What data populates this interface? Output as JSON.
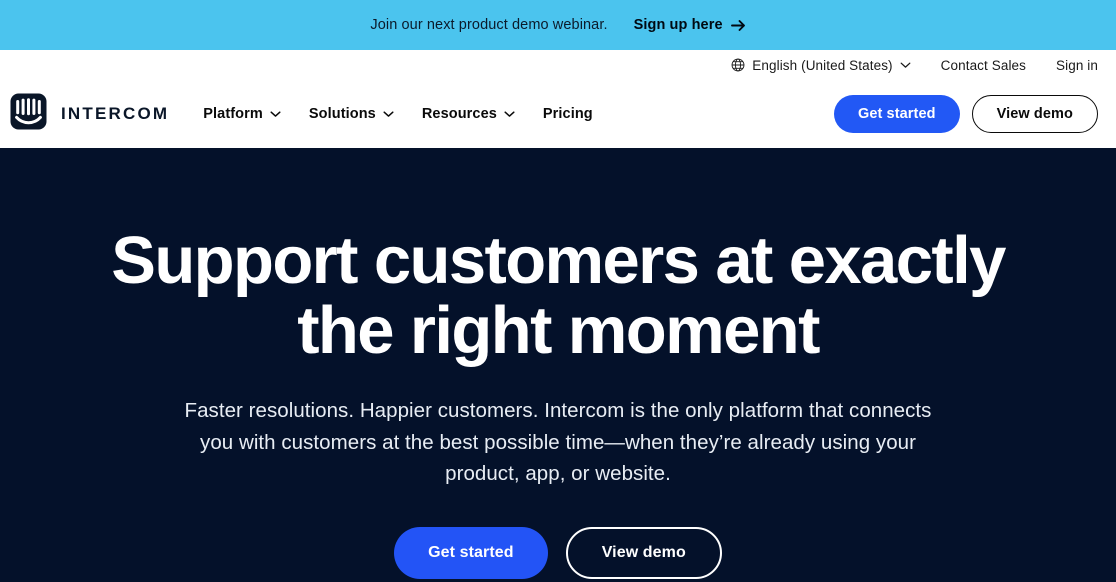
{
  "colors": {
    "banner_bg": "#4BC4EE",
    "header_bg": "#FFFFFF",
    "hero_bg": "#04112A",
    "accent_blue": "#2258F5",
    "text_dark": "#0A0A0A",
    "text_light": "#FFFFFF"
  },
  "banner": {
    "message": "Join our next product demo webinar.",
    "link_label": "Sign up here",
    "arrow_icon": "arrow-right-icon"
  },
  "utility_bar": {
    "globe_icon": "globe-icon",
    "language": "English (United States)",
    "language_chevron_icon": "chevron-down-icon",
    "contact_sales": "Contact Sales",
    "sign_in": "Sign in"
  },
  "header": {
    "logo_icon": "intercom-logo-icon",
    "brand_name": "INTERCOM",
    "nav": [
      {
        "label": "Platform",
        "has_dropdown": true,
        "chevron_icon": "chevron-down-icon"
      },
      {
        "label": "Solutions",
        "has_dropdown": true,
        "chevron_icon": "chevron-down-icon"
      },
      {
        "label": "Resources",
        "has_dropdown": true,
        "chevron_icon": "chevron-down-icon"
      },
      {
        "label": "Pricing",
        "has_dropdown": false
      }
    ],
    "get_started": "Get started",
    "view_demo": "View demo"
  },
  "hero": {
    "title": "Support customers at exactly the right moment",
    "subtitle": "Faster resolutions. Happier customers. Intercom is the only platform that connects you with customers at the best possible time—when they’re already using your product, app, or website.",
    "get_started": "Get started",
    "view_demo": "View demo"
  }
}
